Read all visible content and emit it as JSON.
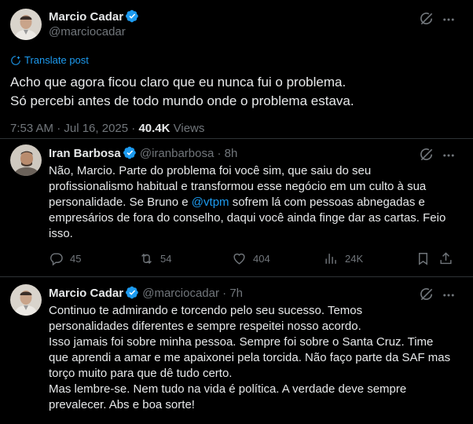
{
  "main_tweet": {
    "author_name": "Marcio Cadar",
    "author_handle": "@marciocadar",
    "translate_label": "Translate post",
    "text_lines": [
      "Acho que agora ficou claro que eu nunca fui o problema.",
      "Só percebi antes de todo mundo onde o problema estava."
    ],
    "timestamp": "7:53 AM · Jul 16, 2025 · ",
    "views_count": "40.4K",
    "views_label": " Views"
  },
  "replies": [
    {
      "author_name": "Iran Barbosa",
      "author_handle": "@iranbarbosa",
      "time": " · 8h",
      "text_lines": [
        "Não, Marcio. Parte do problema foi você sim, que saiu do seu",
        "profissionalismo habitual e transformou esse negócio em um culto à sua",
        "personalidade. Se Bruno e ",
        "@vtpm",
        " sofrem lá com pessoas abnegadas e",
        "empresários de fora do conselho, daqui você ainda finge dar as cartas. Feio",
        "isso."
      ],
      "replies_count": "45",
      "reposts_count": "54",
      "likes_count": "404",
      "views_count": "24K"
    },
    {
      "author_name": "Marcio Cadar",
      "author_handle": "@marciocadar",
      "time": " · 7h",
      "text_lines": [
        "Continuo te admirando e torcendo pelo seu sucesso. Temos",
        "personalidades diferentes e sempre respeitei nosso acordo.",
        "Isso jamais foi sobre minha pessoa. Sempre foi sobre o Santa Cruz. Time",
        "que aprendi a amar e me apaixonei pela torcida. Não faço parte da SAF mas",
        "torço muito para que dê tudo certo.",
        "Mas lembre-se. Nem tudo na vida é política. A verdade deve sempre",
        "prevalecer. Abs e boa sorte!"
      ]
    }
  ],
  "icons": {
    "verified": "verified-badge-icon",
    "grok": "grok-icon",
    "more": "more-icon",
    "translate": "translate-icon",
    "reply": "reply-icon",
    "repost": "repost-icon",
    "like": "like-icon",
    "views": "views-icon",
    "bookmark": "bookmark-icon",
    "share": "share-icon"
  },
  "colors": {
    "background": "#000000",
    "text": "#e7e9ea",
    "secondary": "#71767b",
    "accent": "#1d9bf0",
    "divider": "#2f3336"
  }
}
